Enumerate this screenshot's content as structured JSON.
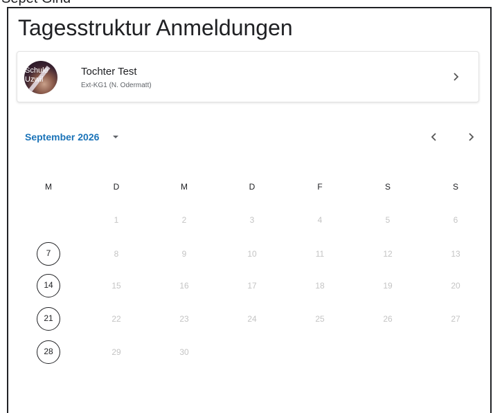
{
  "header": {
    "title": "Tagesstruktur Anmeldungen",
    "top_fragment": "Sepet Gind"
  },
  "student": {
    "name": "Tochter Test",
    "class": "Ext-KG1 (N. Odermatt)",
    "avatar_text": "Schule Uzwil"
  },
  "calendar": {
    "month_label": "September 2026",
    "weekdays": [
      "M",
      "D",
      "M",
      "D",
      "F",
      "S",
      "S"
    ],
    "weeks": [
      [
        null,
        "1",
        "2",
        "3",
        "4",
        "5",
        "6"
      ],
      [
        "7",
        "8",
        "9",
        "10",
        "11",
        "12",
        "13"
      ],
      [
        "14",
        "15",
        "16",
        "17",
        "18",
        "19",
        "20"
      ],
      [
        "21",
        "22",
        "23",
        "24",
        "25",
        "26",
        "27"
      ],
      [
        "28",
        "29",
        "30",
        null,
        null,
        null,
        null
      ]
    ],
    "selectable_days": [
      "7",
      "14",
      "21",
      "28"
    ]
  },
  "colors": {
    "accent": "#1a73b8",
    "text": "#202124",
    "disabled": "#c4c4c4"
  },
  "icons": {
    "card_chevron": "chevron-right-icon",
    "month_caret": "caret-down-icon",
    "prev": "chevron-left-icon",
    "next": "chevron-right-icon"
  }
}
